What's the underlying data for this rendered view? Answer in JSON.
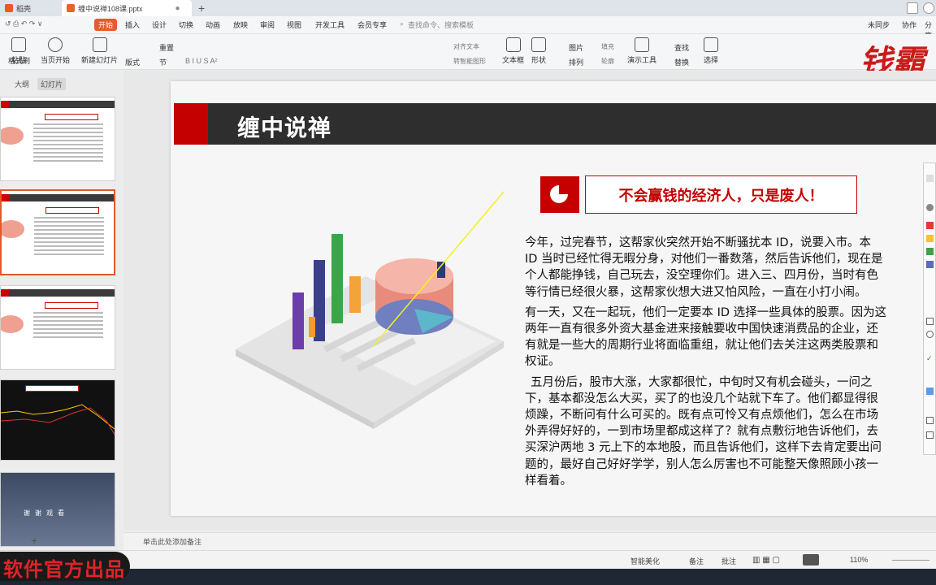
{
  "tabs": [
    {
      "label": "稻壳"
    },
    {
      "label": "缠中说禅108课.pptx"
    }
  ],
  "menu": {
    "items": [
      "开始",
      "插入",
      "设计",
      "切换",
      "动画",
      "放映",
      "审阅",
      "视图",
      "开发工具",
      "会员专享"
    ],
    "search": "查找命令、搜索模板",
    "sync": "未同步",
    "collab": "协作",
    "share": "分享"
  },
  "ribbon": {
    "paste": "粘贴",
    "format_painter": "格式刷",
    "play_from_current": "当页开始",
    "new_slide": "新建幻灯片",
    "layout": "版式",
    "section": "节",
    "reset": "重置",
    "text_box": "文本框",
    "shape": "形状",
    "arrange": "排列",
    "picture": "图片",
    "fill": "填充",
    "outline": "轮廓",
    "present_tool": "演示工具",
    "find": "查找",
    "replace": "替换",
    "select": "选择",
    "align_text": "对齐文本",
    "convert_smartart": "转智能图形"
  },
  "left_panel": {
    "tab_outline": "大纲",
    "tab_slides": "幻灯片",
    "add": "+"
  },
  "slide": {
    "title": "缠中说禅",
    "subtitle": "不会赢钱的经济人，只是废人！",
    "paragraphs": [
      "今年，过完春节，这帮家伙突然开始不断骚扰本 ID，说要入市。本 ID 当时已经忙得无暇分身，对他们一番数落，然后告诉他们，现在是个人都能挣钱，自己玩去，没空理你们。进入三、四月份，当时有色等行情已经很火暴，这帮家伙想大进又怕风险，一直在小打小闹。",
      "有一天，又在一起玩，他们一定要本 ID 选择一些具体的股票。因为这两年一直有很多外资大基金进来接触要收中国快速消费品的企业，还有就是一些大的周期行业将面临重组，就让他们去关注这两类股票和权证。",
      "五月份后，股市大涨，大家都很忙，中旬时又有机会碰头，一问之下，基本都没怎么大买，买了的也没几个站就下车了。他们都显得很烦躁，不断问有什么可买的。既有点可怜又有点烦他们，怎么在市场外弄得好好的，一到市场里都成这样了？就有点敷衍地告诉他们，去买深沪两地 3 元上下的本地股，而且告诉他们，这样下去肯定要出问题的，最好自己好好学学，别人怎么厉害也不可能整天像照顾小孩一样看着。"
    ]
  },
  "notes": {
    "placeholder": "单击此处添加备注"
  },
  "status": {
    "smart_beautify": "智能美化",
    "notes": "备注",
    "comments": "批注",
    "zoom": "110%"
  },
  "watermark": "软件官方出品",
  "brand": "钱霸",
  "colors": {
    "accent": "#c40000",
    "title_bar": "#2e2e2e",
    "menu_active": "#e85a2a"
  }
}
